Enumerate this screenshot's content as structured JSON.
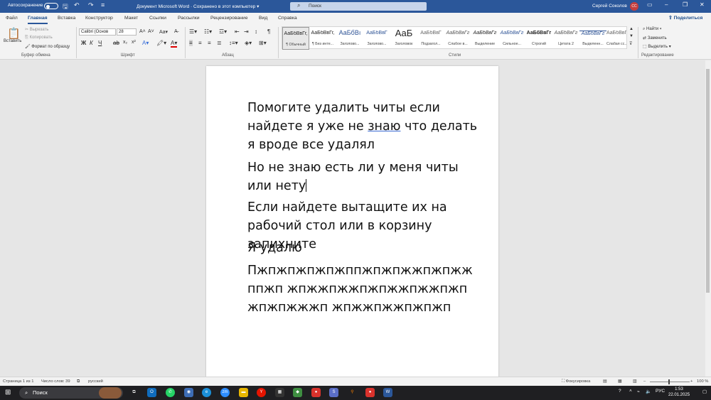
{
  "titlebar": {
    "autosave": "Автосохранение",
    "doc_title": "Документ Microsoft Word  ·  Сохранено в этот компьютер  ▾",
    "search_placeholder": "Поиск",
    "user_name": "Сергей Соколов",
    "user_initials": "СС"
  },
  "tabs": [
    "Файл",
    "Главная",
    "Вставка",
    "Конструктор",
    "Макет",
    "Ссылки",
    "Рассылки",
    "Рецензирование",
    "Вид",
    "Справка"
  ],
  "active_tab": "Главная",
  "share": "Поделиться",
  "ribbon": {
    "clipboard": {
      "paste": "Вставить",
      "cut": "Вырезать",
      "copy": "Копировать",
      "format_painter": "Формат по образцу",
      "group": "Буфер обмена"
    },
    "font": {
      "family": "Calibri (Основ",
      "size": "28",
      "group": "Шрифт"
    },
    "paragraph": {
      "group": "Абзац"
    },
    "styles": {
      "group": "Стили",
      "items": [
        {
          "preview": "АаБбВвГг,",
          "name": "¶ Обычный"
        },
        {
          "preview": "АаБбВвГг,",
          "name": "¶ Без инте..."
        },
        {
          "preview": "АаБбВı",
          "name": "Заголово..."
        },
        {
          "preview": "АаБбВвГ",
          "name": "Заголово..."
        },
        {
          "preview": "АаБ",
          "name": "Заголовок"
        },
        {
          "preview": "АаБбВвГ",
          "name": "Подзагол..."
        },
        {
          "preview": "АаБбВвГг",
          "name": "Слабое в..."
        },
        {
          "preview": "АаБбВвГг",
          "name": "Выделение"
        },
        {
          "preview": "АаБбВвГг",
          "name": "Сильное..."
        },
        {
          "preview": "АаБбВвГг",
          "name": "Строгий"
        },
        {
          "preview": "АаБбВвГг",
          "name": "Цитата 2"
        },
        {
          "preview": "АаБбВвГг",
          "name": "Выделенн..."
        },
        {
          "preview": "АаБбВвГг",
          "name": "Слабая сс..."
        }
      ]
    },
    "editing": {
      "find": "Найти",
      "replace": "Заменить",
      "select": "Выделить",
      "group": "Редактирование"
    }
  },
  "document": {
    "paragraphs": [
      {
        "before": "Помогите удалить читы если найдете я уже не ",
        "marked": "знаю",
        "after": " что делать я вроде все удалял"
      },
      {
        "text": "Но не знаю есть ли у меня читы или нету"
      },
      {
        "text": "Если найдете вытащите их на рабочий стол или в корзину запихните"
      },
      {
        "text": "Я удалю"
      },
      {
        "text": "Пжпжпжпжпжппжпжпжжпжпжжппжп жпжжпжжпжпжжпжжпжпжпжпжжжп жпжжпжжпжпжп"
      }
    ]
  },
  "statusbar": {
    "page": "Страница 1 из 1",
    "words": "Число слов: 39",
    "language": "русский",
    "focus": "Фокусировка",
    "zoom": "100 %"
  },
  "taskbar": {
    "search": "Поиск",
    "language": "РУС",
    "time": "1:53",
    "date": "22.01.2025"
  },
  "colors": {
    "accent": "#2b579a",
    "avatar": "#c43e3e"
  }
}
